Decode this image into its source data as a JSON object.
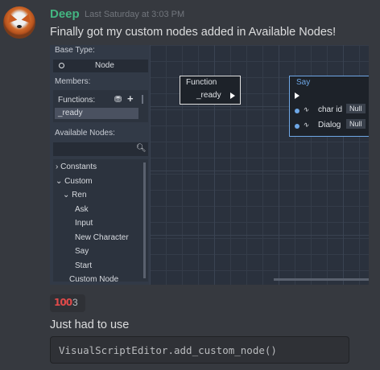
{
  "message": {
    "username": "Deep",
    "timestamp": "Last Saturday at 3:03 PM",
    "text": "Finally got my custom nodes added in Available Nodes!",
    "username_color": "#43b581"
  },
  "editor": {
    "base_type_label": "Base Type:",
    "base_type_value": "Node",
    "members_label": "Members:",
    "functions_label": "Functions:",
    "function_item": "_ready",
    "available_nodes_label": "Available Nodes:",
    "tree": [
      "Constants",
      "Custom",
      "Ren",
      "Ask",
      "Input",
      "New Character",
      "Say",
      "Start",
      "Custom Node"
    ],
    "function_node": {
      "title": "Function",
      "output": "_ready"
    },
    "say_node": {
      "title": "Say",
      "params": [
        {
          "name": "char id",
          "value": "Null"
        },
        {
          "name": "Dialog",
          "value": "Null"
        }
      ],
      "accent": "#6ea7e6"
    }
  },
  "reaction": {
    "emoji": "💯",
    "count": "3"
  },
  "followup": {
    "text": "Just had to use",
    "code": "VisualScriptEditor.add_custom_node()"
  }
}
